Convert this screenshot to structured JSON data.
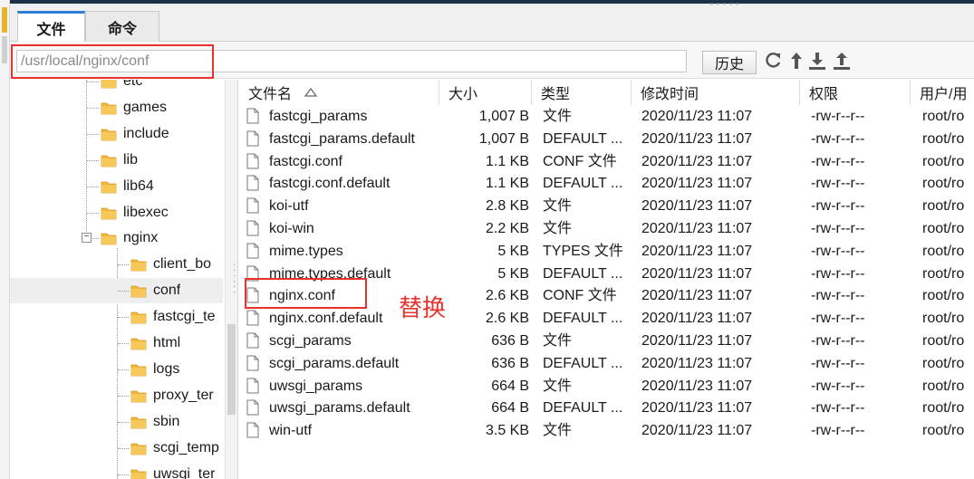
{
  "tabs": [
    {
      "label": "文件",
      "active": true
    },
    {
      "label": "命令",
      "active": false
    }
  ],
  "path": {
    "value": "/usr/local/nginx/conf"
  },
  "toolbar": {
    "history_label": "历史",
    "icons": [
      "refresh-icon",
      "up-arrow-icon",
      "download-icon",
      "upload-icon"
    ]
  },
  "tree": {
    "items": [
      {
        "label": "etc",
        "level": 1
      },
      {
        "label": "games",
        "level": 1
      },
      {
        "label": "include",
        "level": 1
      },
      {
        "label": "lib",
        "level": 1
      },
      {
        "label": "lib64",
        "level": 1
      },
      {
        "label": "libexec",
        "level": 1
      },
      {
        "label": "nginx",
        "level": 1,
        "expanded": true
      },
      {
        "label": "client_bo",
        "level": 2
      },
      {
        "label": "conf",
        "level": 2,
        "selected": true
      },
      {
        "label": "fastcgi_te",
        "level": 2
      },
      {
        "label": "html",
        "level": 2
      },
      {
        "label": "logs",
        "level": 2
      },
      {
        "label": "proxy_ter",
        "level": 2
      },
      {
        "label": "sbin",
        "level": 2
      },
      {
        "label": "scgi_temp",
        "level": 2
      },
      {
        "label": "uwsgi_ter",
        "level": 2
      }
    ]
  },
  "columns": {
    "name": "文件名",
    "size": "大小",
    "type": "类型",
    "modified": "修改时间",
    "perms": "权限",
    "owner": "用户/用"
  },
  "files": [
    {
      "name": "fastcgi_params",
      "size": "1,007 B",
      "type": "文件",
      "modified": "2020/11/23 11:07",
      "perms": "-rw-r--r--",
      "owner": "root/ro"
    },
    {
      "name": "fastcgi_params.default",
      "size": "1,007 B",
      "type": "DEFAULT ...",
      "modified": "2020/11/23 11:07",
      "perms": "-rw-r--r--",
      "owner": "root/ro"
    },
    {
      "name": "fastcgi.conf",
      "size": "1.1 KB",
      "type": "CONF 文件",
      "modified": "2020/11/23 11:07",
      "perms": "-rw-r--r--",
      "owner": "root/ro"
    },
    {
      "name": "fastcgi.conf.default",
      "size": "1.1 KB",
      "type": "DEFAULT ...",
      "modified": "2020/11/23 11:07",
      "perms": "-rw-r--r--",
      "owner": "root/ro"
    },
    {
      "name": "koi-utf",
      "size": "2.8 KB",
      "type": "文件",
      "modified": "2020/11/23 11:07",
      "perms": "-rw-r--r--",
      "owner": "root/ro"
    },
    {
      "name": "koi-win",
      "size": "2.2 KB",
      "type": "文件",
      "modified": "2020/11/23 11:07",
      "perms": "-rw-r--r--",
      "owner": "root/ro"
    },
    {
      "name": "mime.types",
      "size": "5 KB",
      "type": "TYPES 文件",
      "modified": "2020/11/23 11:07",
      "perms": "-rw-r--r--",
      "owner": "root/ro"
    },
    {
      "name": "mime.types.default",
      "size": "5 KB",
      "type": "DEFAULT ...",
      "modified": "2020/11/23 11:07",
      "perms": "-rw-r--r--",
      "owner": "root/ro"
    },
    {
      "name": "nginx.conf",
      "size": "2.6 KB",
      "type": "CONF 文件",
      "modified": "2020/11/23 11:07",
      "perms": "-rw-r--r--",
      "owner": "root/ro"
    },
    {
      "name": "nginx.conf.default",
      "size": "2.6 KB",
      "type": "DEFAULT ...",
      "modified": "2020/11/23 11:07",
      "perms": "-rw-r--r--",
      "owner": "root/ro"
    },
    {
      "name": "scgi_params",
      "size": "636 B",
      "type": "文件",
      "modified": "2020/11/23 11:07",
      "perms": "-rw-r--r--",
      "owner": "root/ro"
    },
    {
      "name": "scgi_params.default",
      "size": "636 B",
      "type": "DEFAULT ...",
      "modified": "2020/11/23 11:07",
      "perms": "-rw-r--r--",
      "owner": "root/ro"
    },
    {
      "name": "uwsgi_params",
      "size": "664 B",
      "type": "文件",
      "modified": "2020/11/23 11:07",
      "perms": "-rw-r--r--",
      "owner": "root/ro"
    },
    {
      "name": "uwsgi_params.default",
      "size": "664 B",
      "type": "DEFAULT ...",
      "modified": "2020/11/23 11:07",
      "perms": "-rw-r--r--",
      "owner": "root/ro"
    },
    {
      "name": "win-utf",
      "size": "3.5 KB",
      "type": "文件",
      "modified": "2020/11/23 11:07",
      "perms": "-rw-r--r--",
      "owner": "root/ro"
    }
  ],
  "annotation": {
    "text": "替换",
    "color": "#e8322d"
  },
  "colors": {
    "highlight_box": "#e8322d",
    "folder": "#f1b73a",
    "active_tab_accent": "#2f7fd3"
  }
}
